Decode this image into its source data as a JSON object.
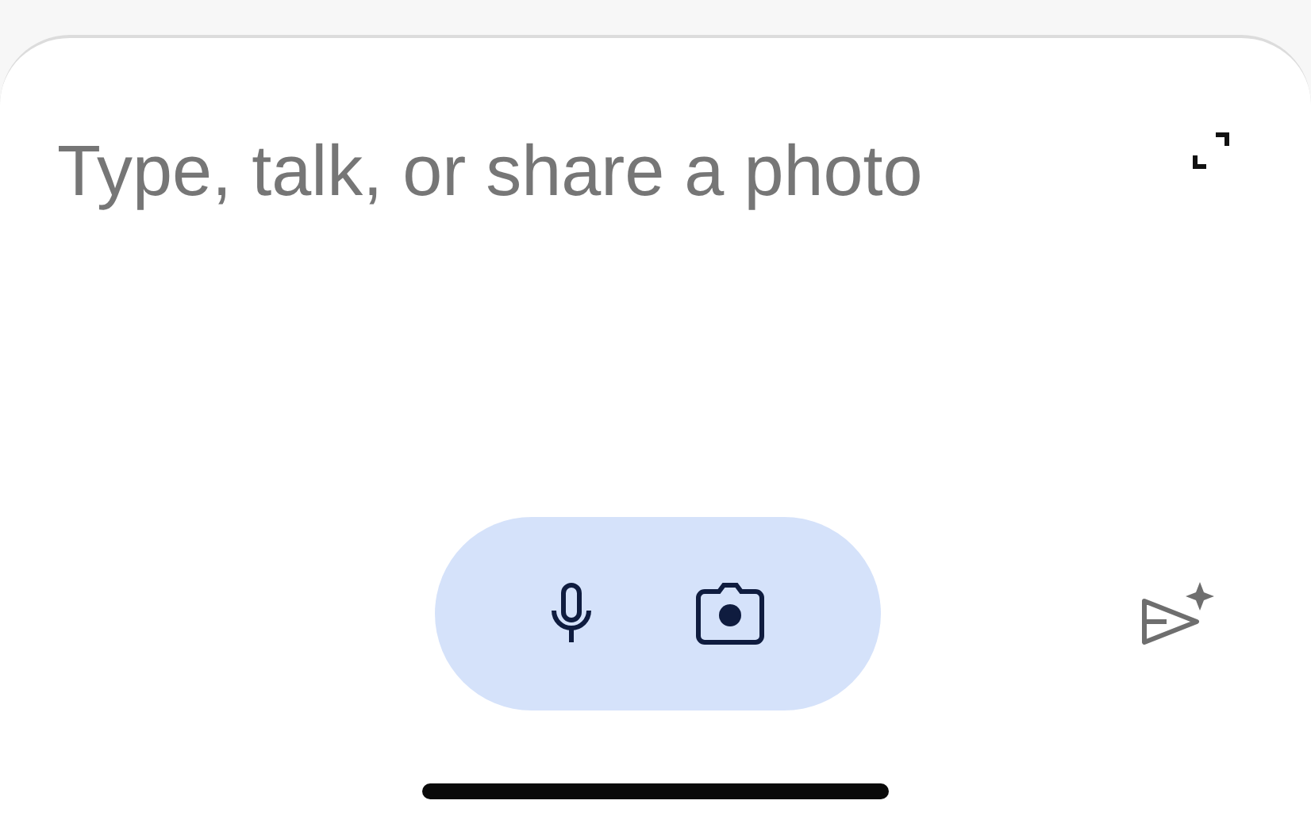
{
  "composer": {
    "placeholder": "Type, talk, or share a photo"
  }
}
